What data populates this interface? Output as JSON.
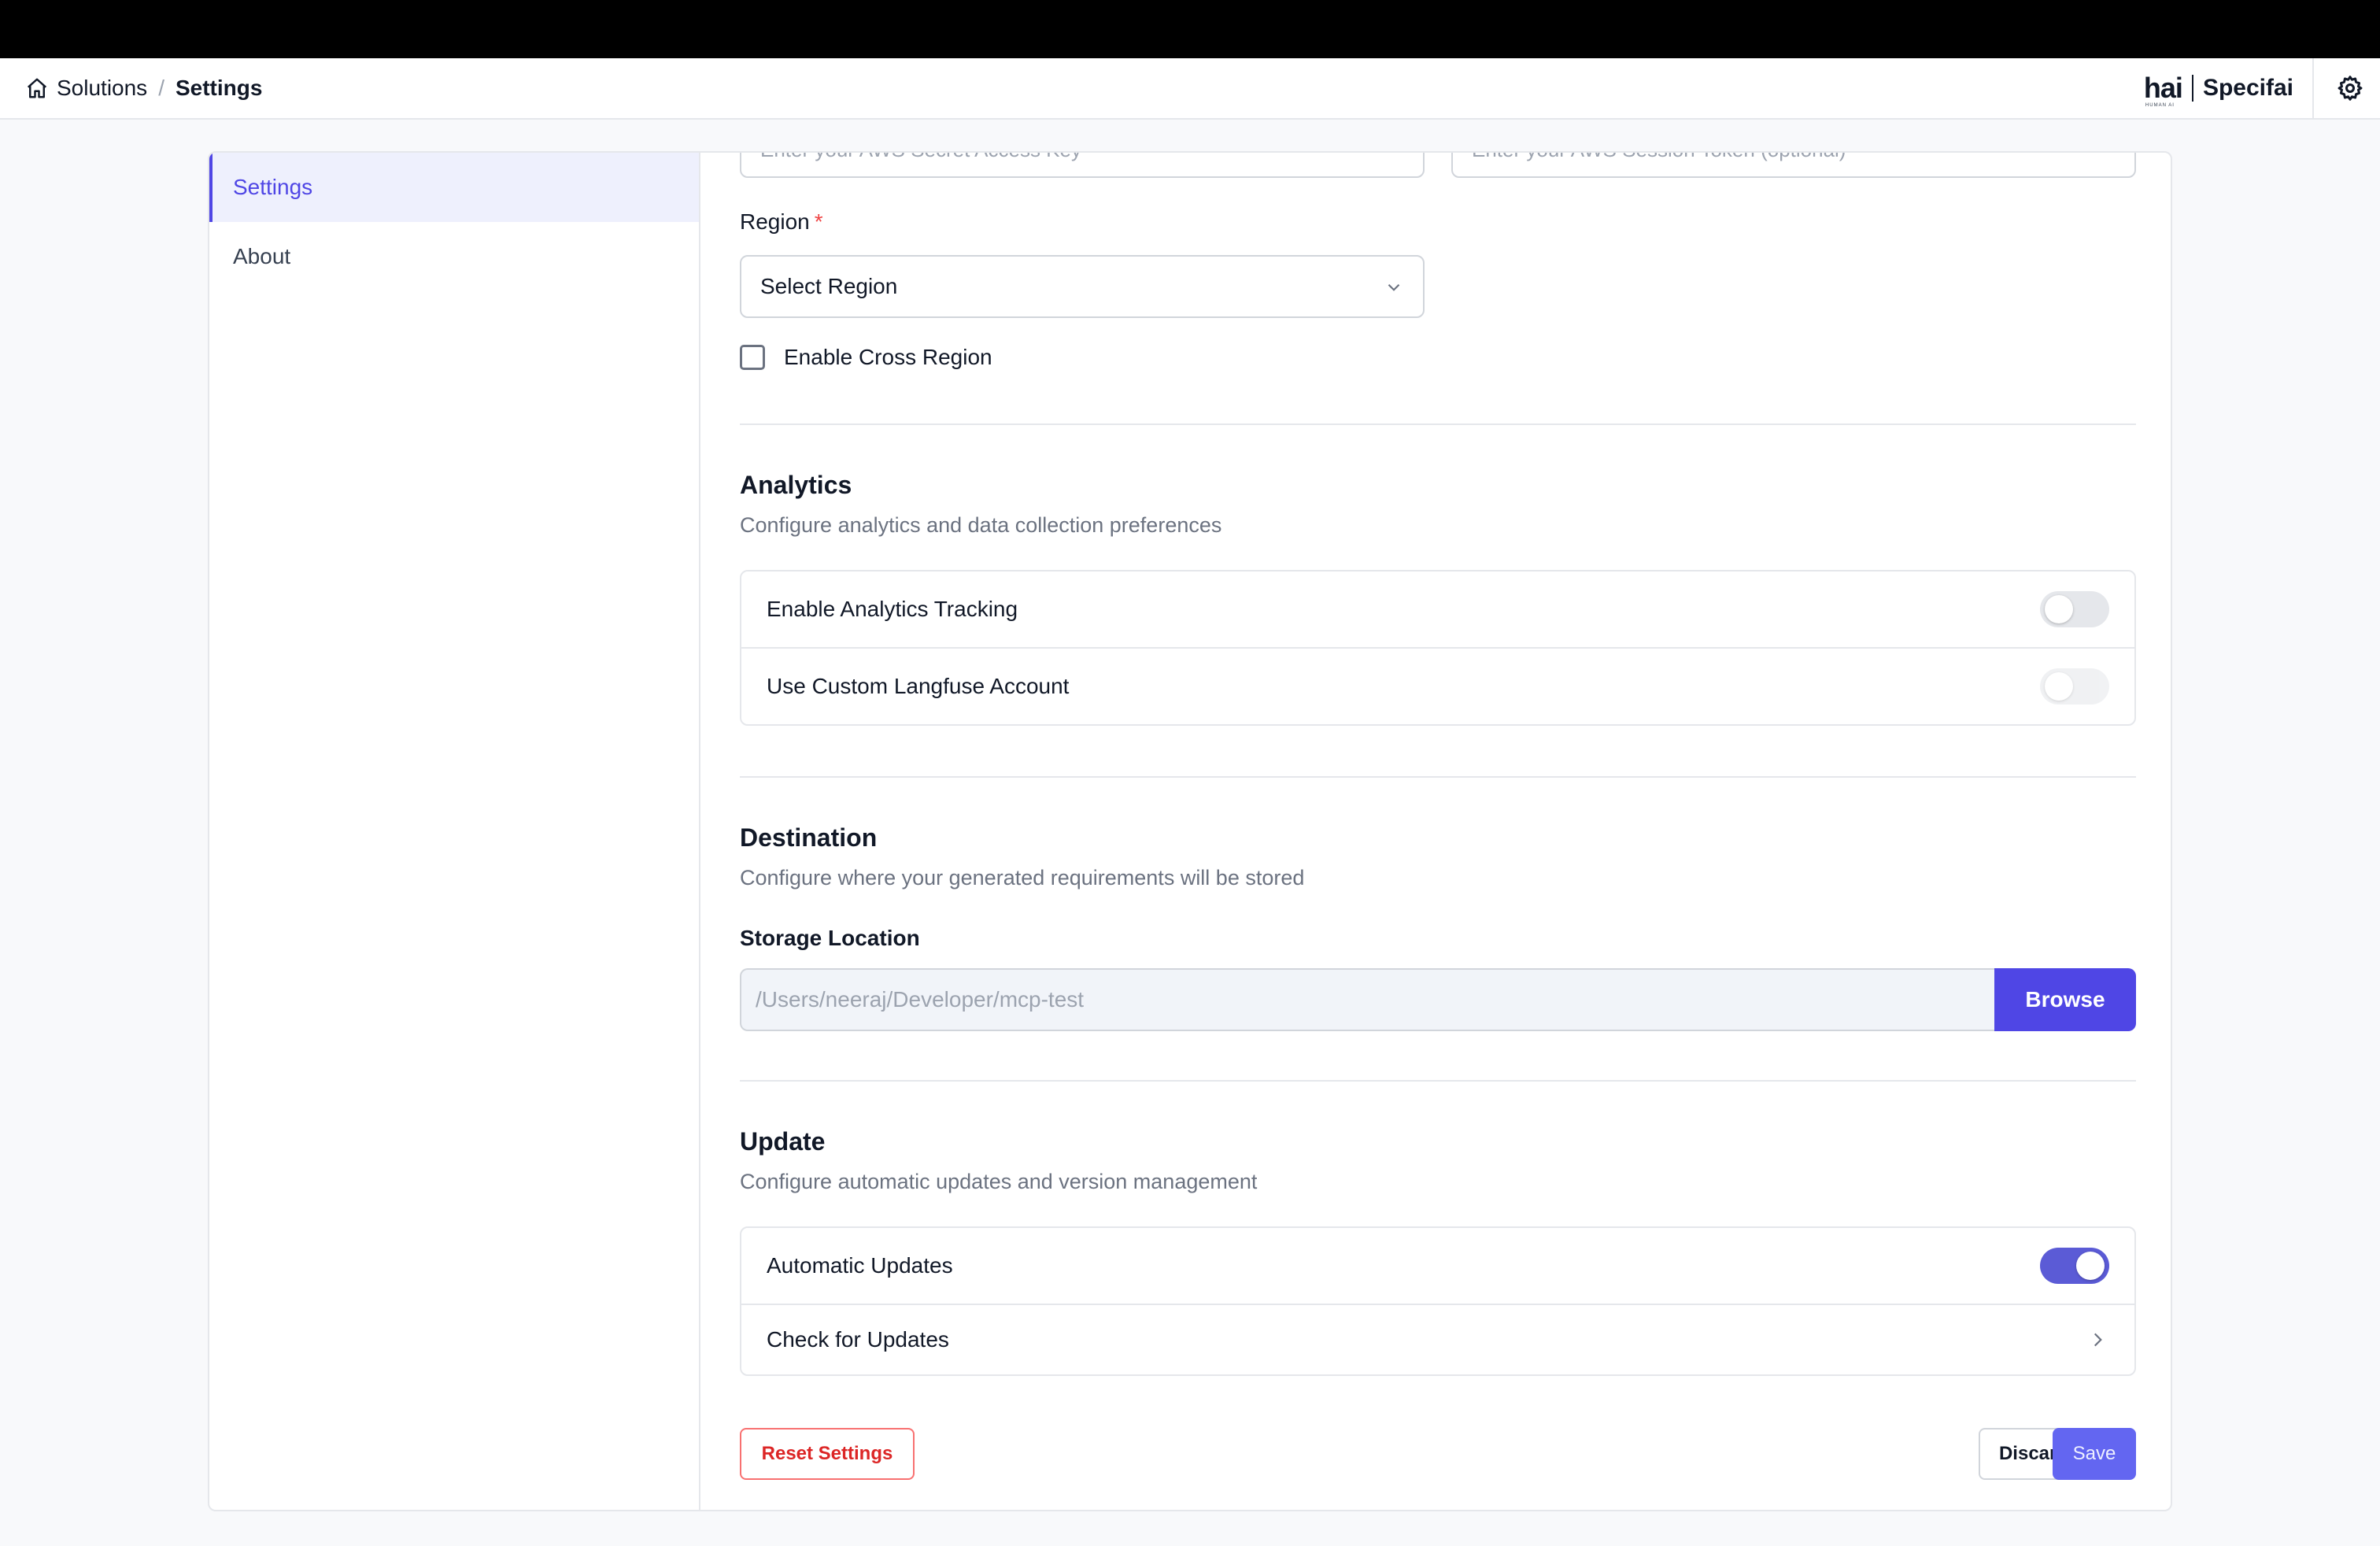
{
  "breadcrumb": {
    "root": "Solutions",
    "separator": "/",
    "current": "Settings"
  },
  "brand": {
    "logo": "hai",
    "logo_sub": "HUMAN AI",
    "name": "Specifai"
  },
  "sidebar": {
    "items": [
      {
        "label": "Settings",
        "active": true
      },
      {
        "label": "About",
        "active": false
      }
    ]
  },
  "aws": {
    "secret_key_placeholder": "Enter your AWS Secret Access Key",
    "session_token_placeholder": "Enter your AWS Session Token (optional)",
    "region_label": "Region",
    "region_required": "*",
    "region_value": "Select Region",
    "cross_region_label": "Enable Cross Region",
    "cross_region_checked": false
  },
  "analytics": {
    "title": "Analytics",
    "description": "Configure analytics and data collection preferences",
    "rows": [
      {
        "label": "Enable Analytics Tracking",
        "enabled": false
      },
      {
        "label": "Use Custom Langfuse Account",
        "enabled": false
      }
    ]
  },
  "destination": {
    "title": "Destination",
    "description": "Configure where your generated requirements will be stored",
    "storage_label": "Storage Location",
    "storage_path": "/Users/neeraj/Developer/mcp-test",
    "browse_label": "Browse"
  },
  "update": {
    "title": "Update",
    "description": "Configure automatic updates and version management",
    "auto_label": "Automatic Updates",
    "auto_enabled": true,
    "check_label": "Check for Updates"
  },
  "actions": {
    "reset": "Reset Settings",
    "discard": "Discard",
    "save": "Save"
  },
  "colors": {
    "accent": "#4f46e5",
    "danger": "#dc2626"
  }
}
